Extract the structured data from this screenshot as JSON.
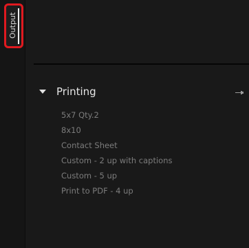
{
  "left_tabs": {
    "output_label": "Output"
  },
  "section": {
    "title": "Printing",
    "items": [
      {
        "label": "5x7 Qty.2"
      },
      {
        "label": "8x10"
      },
      {
        "label": "Contact Sheet"
      },
      {
        "label": "Custom - 2 up with captions"
      },
      {
        "label": "Custom - 5 up"
      },
      {
        "label": "Print to PDF - 4 up"
      }
    ]
  },
  "icons": {
    "disclosure": "triangle-down-icon",
    "pin": "pin-icon"
  },
  "colors": {
    "highlight_border": "#e0191f",
    "background": "#191919",
    "item_text": "#7c7c7c",
    "header_text": "#e6e6e6"
  }
}
